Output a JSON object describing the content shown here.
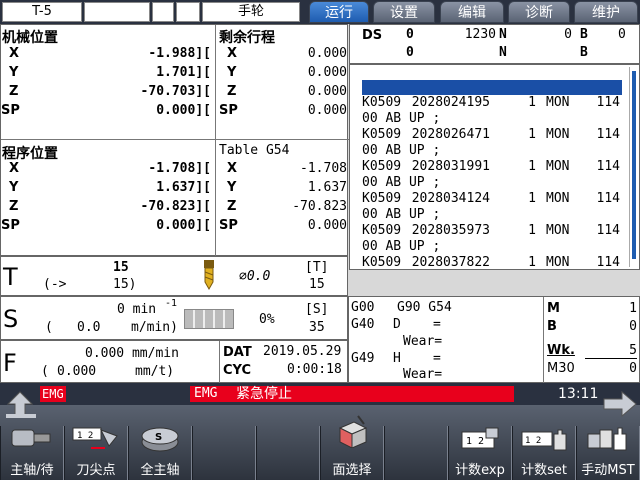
{
  "header": {
    "tool_name": "T-5",
    "mode": "手轮",
    "tabs": [
      "运行",
      "设置",
      "编辑",
      "诊断",
      "维护"
    ],
    "active_tab": "运行"
  },
  "machine_pos": {
    "title": "机械位置",
    "rows": [
      {
        "axis": "X",
        "value": "-1.988]["
      },
      {
        "axis": "Y",
        "value": "1.701]["
      },
      {
        "axis": "Z",
        "value": "-70.703]["
      },
      {
        "axis": "SP",
        "value": "0.000]["
      }
    ]
  },
  "remaining": {
    "title": "剩余行程",
    "rows": [
      {
        "axis": "X",
        "value": "0.000"
      },
      {
        "axis": "Y",
        "value": "0.000"
      },
      {
        "axis": "Z",
        "value": "0.000"
      },
      {
        "axis": "SP",
        "value": "0.000"
      }
    ]
  },
  "program_pos": {
    "title": "程序位置",
    "rows": [
      {
        "axis": "X",
        "value": "-1.708]["
      },
      {
        "axis": "Y",
        "value": "1.637]["
      },
      {
        "axis": "Z",
        "value": "-70.823]["
      },
      {
        "axis": "SP",
        "value": "0.000]["
      }
    ]
  },
  "table_pos": {
    "title": "Table  G54",
    "rows": [
      {
        "axis": "X",
        "value": "-1.708"
      },
      {
        "axis": "Y",
        "value": "1.637"
      },
      {
        "axis": "Z",
        "value": "-70.823"
      },
      {
        "axis": "SP",
        "value": "0.000"
      }
    ]
  },
  "ds": {
    "label": "DS",
    "r1": {
      "a": "0",
      "b": "1230",
      "n": "N",
      "c": "0",
      "bl": "B",
      "d": "0"
    },
    "r2": {
      "a": "0",
      "n": "N",
      "bl": "B"
    }
  },
  "alarms": [
    {
      "code": "K0509",
      "id": "2028024195",
      "n": "1",
      "day": "MON",
      "num": "114",
      "msg": "00 AB UP    ;"
    },
    {
      "code": "K0509",
      "id": "2028026471",
      "n": "1",
      "day": "MON",
      "num": "114",
      "msg": "00 AB UP    ;"
    },
    {
      "code": "K0509",
      "id": "2028031991",
      "n": "1",
      "day": "MON",
      "num": "114",
      "msg": "00 AB UP    ;"
    },
    {
      "code": "K0509",
      "id": "2028034124",
      "n": "1",
      "day": "MON",
      "num": "114",
      "msg": "00 AB UP    ;"
    },
    {
      "code": "K0509",
      "id": "2028035973",
      "n": "1",
      "day": "MON",
      "num": "114",
      "msg": "00 AB UP    ;"
    },
    {
      "code": "K0509",
      "id": "2028037822",
      "n": "1",
      "day": "MON",
      "num": "114",
      "msg": ""
    }
  ],
  "tool": {
    "label": "T",
    "num": "15",
    "arrow": "(->",
    "next": "15)",
    "dia": "⌀0.0",
    "t_label": "[T]",
    "t_val": "15"
  },
  "spindle": {
    "label": "S",
    "speed": "0 min",
    "sup": "-1",
    "paren": "(",
    "feed_val": "0.0",
    "feed_unit": "m/min)",
    "pct": "0%",
    "s_label": "[S]",
    "s_val": "35"
  },
  "feed": {
    "label": "F",
    "val": "0.000 mm/min",
    "paren": "(",
    "val2": "0.000",
    "unit2": "mm/t)"
  },
  "datetime": {
    "dat_label": "DAT",
    "date": "2019.05.29",
    "cyc_label": "CYC",
    "cyc": "0:00:18"
  },
  "gcodes": {
    "l1a": "G00",
    "l1b": "G90 G54",
    "l2a": "G40",
    "l2b": "D",
    "l2c": "=",
    "l3": "Wear=",
    "l4a": "G49",
    "l4b": "H",
    "l4c": "=",
    "l5": "Wear="
  },
  "mbw": {
    "m_label": "M",
    "m_val": "1",
    "b_label": "B",
    "b_val": "0",
    "wk_label": "Wk.",
    "wk_val": "5",
    "m30_label": "M30",
    "m30_val": "0"
  },
  "status": {
    "emg1": "EMG",
    "emg2": "EMG",
    "msg": "紧急停止",
    "time": "13:11"
  },
  "softkeys": [
    {
      "label": "主轴/待"
    },
    {
      "label": "刀尖点"
    },
    {
      "label": "全主轴"
    },
    {
      "label": "面选择"
    },
    {
      "label": "计数exp"
    },
    {
      "label": "计数set"
    },
    {
      "label": "手动MST"
    }
  ],
  "colors": {
    "accent": "#1e5cb0",
    "emg_bar": "#e8001c",
    "selection": "#1a4fa6"
  }
}
